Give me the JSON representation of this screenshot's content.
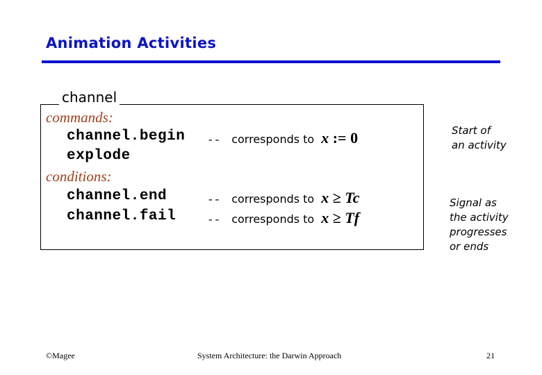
{
  "slide": {
    "title": "Animation Activities",
    "box": {
      "legend": "channel",
      "commands_label": "commands:",
      "conditions_label": "conditions:",
      "rows": [
        {
          "code": "channel.begin",
          "dash": "--",
          "text": "corresponds to",
          "math_var": "x",
          "math_op": ":=",
          "math_val": "0"
        },
        {
          "code": "explode"
        },
        {
          "code": "channel.end",
          "dash": "--",
          "text": "corresponds to",
          "math_var": "x",
          "math_op": "≥",
          "math_val": "Tc"
        },
        {
          "code": "channel.fail",
          "dash": "--",
          "text": "corresponds to",
          "math_var": "x",
          "math_op": "≥",
          "math_val": "Tf"
        }
      ]
    },
    "notes": [
      {
        "lines": [
          "Start of",
          "an activity"
        ]
      },
      {
        "lines": [
          "Signal as",
          "the activity",
          "progresses",
          "or ends"
        ]
      }
    ]
  },
  "footer": {
    "left": "©Magee",
    "center": "System Architecture: the Darwin Approach",
    "page_number": "21"
  }
}
